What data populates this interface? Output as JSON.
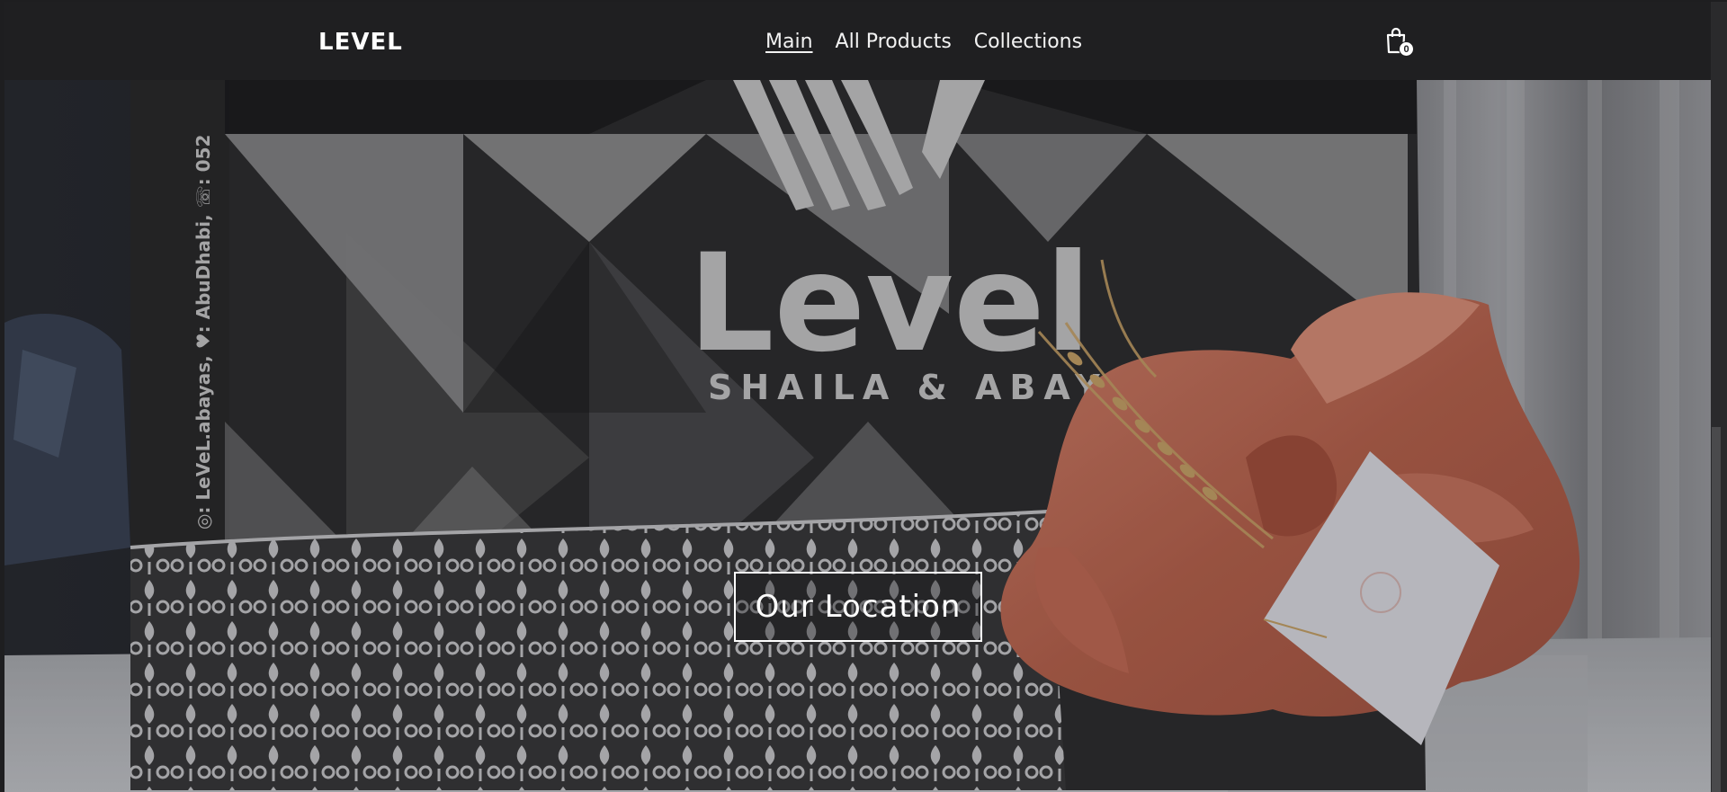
{
  "header": {
    "logo": "LEVEL",
    "nav": [
      {
        "label": "Main",
        "active": true
      },
      {
        "label": "All Products",
        "active": false
      },
      {
        "label": "Collections",
        "active": false
      }
    ],
    "cart_count": "0"
  },
  "hero": {
    "bag_brand": "Level",
    "bag_tagline": "SHAILA & ABAYA",
    "bag_side_text": "◎: LeVeL.abayas, ♥: AbuDhabi, ☏: 052",
    "location_button": "Our Location"
  },
  "colors": {
    "header_bg": "#1f1f21",
    "gift_wrap": "#c97560",
    "bag_dark": "#2e2e30",
    "bag_light": "#8d8d8f"
  }
}
